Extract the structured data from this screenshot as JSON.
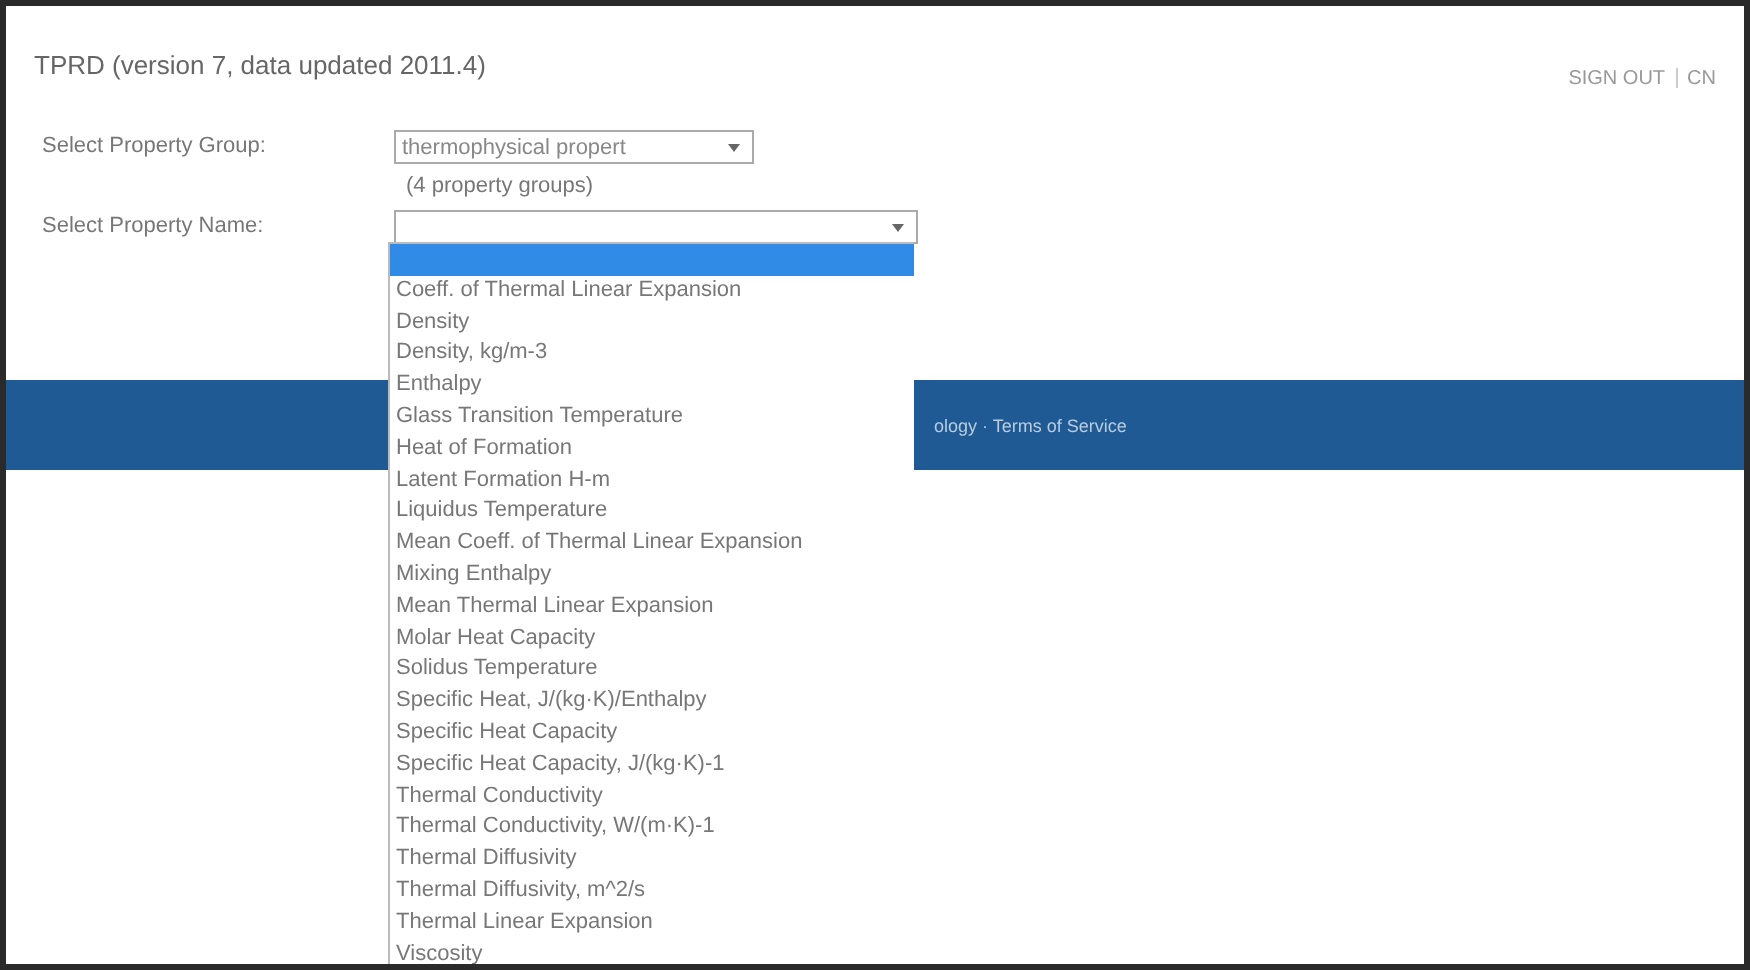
{
  "header": {
    "title": "TPRD (version 7, data updated 2011.4)",
    "links": [
      "SIGN OUT",
      "CN"
    ]
  },
  "form": {
    "group_label": "Select Property Group:",
    "group_value": "thermophysical propert",
    "group_count": "(4 property groups)",
    "name_label": "Select Property Name:"
  },
  "dropdown": {
    "options": [
      {
        "selected": true
      },
      {
        "label": "Coeff. of Thermal Linear Expansion",
        "selected": false
      },
      {
        "label": "Density",
        "selected": false
      },
      {
        "label": "Density, kg/m-3",
        "selected": false
      },
      {
        "label": "Enthalpy",
        "selected": false
      },
      {
        "label": "Glass Transition Temperature",
        "selected": false
      },
      {
        "label": "Heat of Formation",
        "selected": false
      },
      {
        "label": "Latent Formation H-m",
        "selected": false
      },
      {
        "label": "Liquidus Temperature",
        "selected": false
      },
      {
        "label": "Mean Coeff. of Thermal Linear Expansion",
        "selected": false
      },
      {
        "label": "Mixing Enthalpy",
        "selected": false
      },
      {
        "label": "Mean Thermal Linear Expansion",
        "selected": false
      },
      {
        "label": "Molar Heat Capacity",
        "selected": false
      },
      {
        "label": "Solidus Temperature",
        "selected": false
      },
      {
        "label": "Specific Heat, J/(kg·K)/Enthalpy",
        "selected": false
      },
      {
        "label": "Specific Heat Capacity",
        "selected": false
      },
      {
        "label": "Specific Heat Capacity, J/(kg·K)-1",
        "selected": false
      },
      {
        "label": "Thermal Conductivity",
        "selected": false
      },
      {
        "label": "Thermal Conductivity, W/(m·K)-1",
        "selected": false
      },
      {
        "label": "Thermal Diffusivity",
        "selected": false
      },
      {
        "label": "Thermal Diffusivity, m^2/s",
        "selected": false
      },
      {
        "label": "Thermal Linear Expansion",
        "selected": false
      },
      {
        "label": "Viscosity",
        "selected": false
      }
    ]
  },
  "footer": {
    "text": "ology · Terms of Service"
  }
}
